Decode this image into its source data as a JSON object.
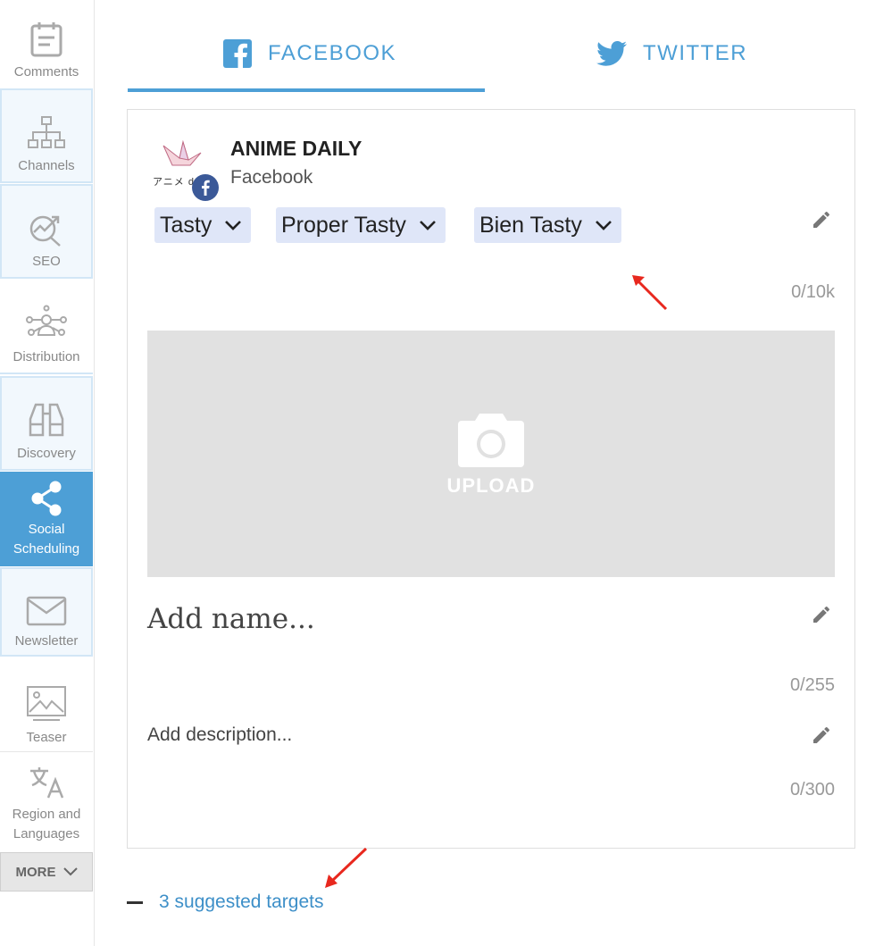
{
  "sidebar": {
    "items": [
      {
        "label": "Comments",
        "icon": "comments-icon"
      },
      {
        "label": "Channels",
        "icon": "channels-icon"
      },
      {
        "label": "SEO",
        "icon": "seo-icon"
      },
      {
        "label": "Distribution",
        "icon": "distribution-icon"
      },
      {
        "label": "Discovery",
        "icon": "binoculars-icon"
      },
      {
        "label": "Social Scheduling",
        "icon": "share-icon"
      },
      {
        "label": "Newsletter",
        "icon": "envelope-icon"
      },
      {
        "label": "Teaser",
        "icon": "image-icon"
      },
      {
        "label": "Region and Languages",
        "icon": "translate-icon"
      }
    ],
    "more_label": "MORE"
  },
  "tabs": {
    "facebook": "FACEBOOK",
    "twitter": "TWITTER"
  },
  "card": {
    "account_name": "ANIME DAILY",
    "account_platform": "Facebook",
    "avatar_text": "アニメ da",
    "targets": [
      "Tasty",
      "Proper Tasty",
      "Bien Tasty"
    ],
    "message_counter": "0/10k",
    "upload_label": "UPLOAD",
    "name_placeholder": "Add name...",
    "name_counter": "0/255",
    "description_placeholder": "Add description...",
    "description_counter": "0/300"
  },
  "suggested_targets": "3 suggested targets",
  "colors": {
    "accent": "#4d9fd6",
    "chip_bg": "#dfe6f8",
    "facebook": "#3b5998",
    "annotation_arrow": "#e8281e"
  }
}
